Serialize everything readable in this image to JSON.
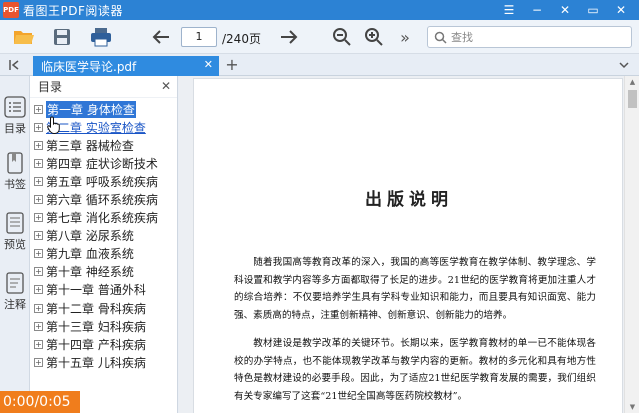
{
  "app": {
    "logo_text": "PDF",
    "title": "看图王PDF阅读器",
    "window_controls": [
      "☰",
      "−",
      "✕",
      "▭",
      "✕"
    ]
  },
  "toolbar": {
    "current_page": "1",
    "total_pages": "/240页",
    "more_label": "»",
    "search_placeholder": "查找"
  },
  "tabs": {
    "active_tab": "临床医学导论.pdf",
    "close_label": "✕",
    "new_tab_label": "+"
  },
  "sidebar": {
    "items": [
      {
        "label": "目录"
      },
      {
        "label": "书签"
      },
      {
        "label": "预览"
      },
      {
        "label": "注释"
      }
    ]
  },
  "outline": {
    "header": "目录",
    "close_label": "✕",
    "chapters": [
      "第一章 身体检查",
      "第二章 实验室检查",
      "第三章 器械检查",
      "第四章 症状诊断技术",
      "第五章 呼吸系统疾病",
      "第六章 循环系统疾病",
      "第七章 消化系统疾病",
      "第八章 泌尿系统",
      "第九章 血液系统",
      "第十章 神经系统",
      "第十一章 普通外科",
      "第十二章 骨科疾病",
      "第十三章 妇科疾病",
      "第十四章 产科疾病",
      "第十五章 儿科疾病"
    ]
  },
  "document": {
    "heading": "出版说明",
    "paragraph1": "随着我国高等教育改革的深入，我国的高等医学教育在教学体制、教学理念、学科设置和教学内容等多方面都取得了长足的进步。21世纪的医学教育将更加注重人才的综合培养：不仅要培养学生具有学科专业知识和能力，而且要具有知识面宽、能力强、素质高的特点，注重创新精神、创新意识、创新能力的培养。",
    "paragraph2": "教材建设是教学改革的关键环节。长期以来，医学教育教材的单一已不能体现各校的办学特点，也不能体现教学改革与教学内容的更新。教材的多元化和具有地方性特色是教材建设的必要手段。因此，为了适应21世纪医学教育发展的需要，我们组织有关专家编写了这套“21世纪全国高等医药院校教材”。"
  },
  "video": {
    "timer": "0:00/0:05"
  }
}
